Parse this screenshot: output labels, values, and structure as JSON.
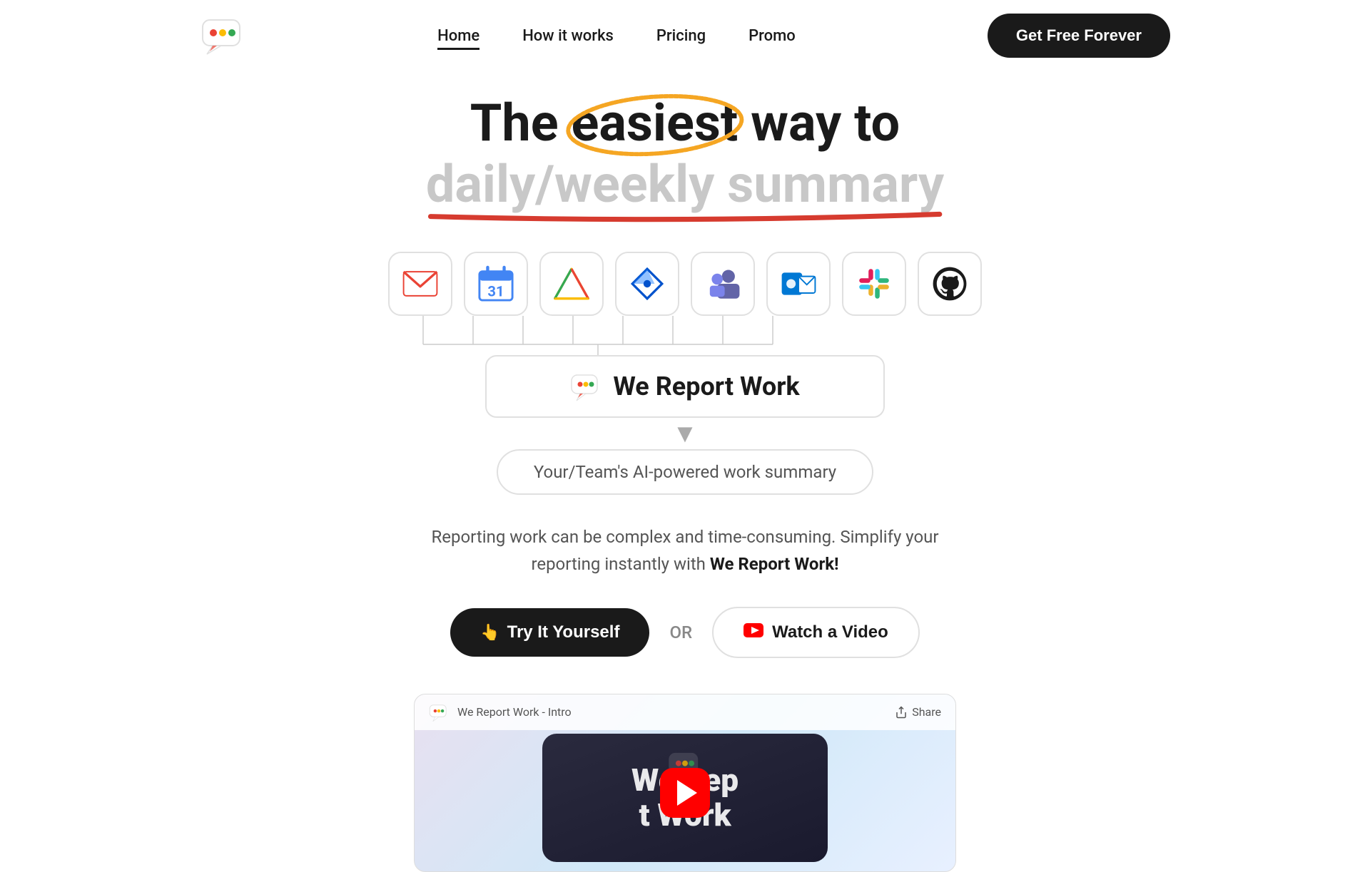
{
  "nav": {
    "links": [
      {
        "label": "Home",
        "active": true
      },
      {
        "label": "How it works",
        "active": false
      },
      {
        "label": "Pricing",
        "active": false
      },
      {
        "label": "Promo",
        "active": false
      }
    ],
    "cta_button": "Get Free Forever"
  },
  "hero": {
    "title_line1_prefix": "The ",
    "title_highlighted": "easiest",
    "title_line1_suffix": " way to",
    "title_line2": "daily/weekly summary",
    "wrw_label": "We Report Work",
    "summary_label": "Your/Team's AI-powered work summary",
    "description": "Reporting work can be complex and time-consuming. Simplify your reporting instantly with ",
    "description_bold": "We Report Work!",
    "btn_try": "Try It Yourself",
    "or_text": "OR",
    "btn_watch": "Watch a Video",
    "video_title": "We Report Work - Intro",
    "video_tablet_text": "We Rep​t Work"
  },
  "icons": [
    {
      "label": "Gmail",
      "emoji": "M",
      "color": "#EA4335"
    },
    {
      "label": "Google Calendar",
      "emoji": "31",
      "color": "#4285F4"
    },
    {
      "label": "Google Drive",
      "emoji": "▲",
      "color": "#FBBC04"
    },
    {
      "label": "Jira",
      "emoji": "⦿",
      "color": "#0052CC"
    },
    {
      "label": "Microsoft Teams",
      "emoji": "T",
      "color": "#6264A7"
    },
    {
      "label": "Outlook",
      "emoji": "O",
      "color": "#0078D4"
    },
    {
      "label": "Slack",
      "emoji": "#",
      "color": "#E01E5A"
    },
    {
      "label": "GitHub",
      "emoji": "♥",
      "color": "#1a1a1a"
    }
  ]
}
